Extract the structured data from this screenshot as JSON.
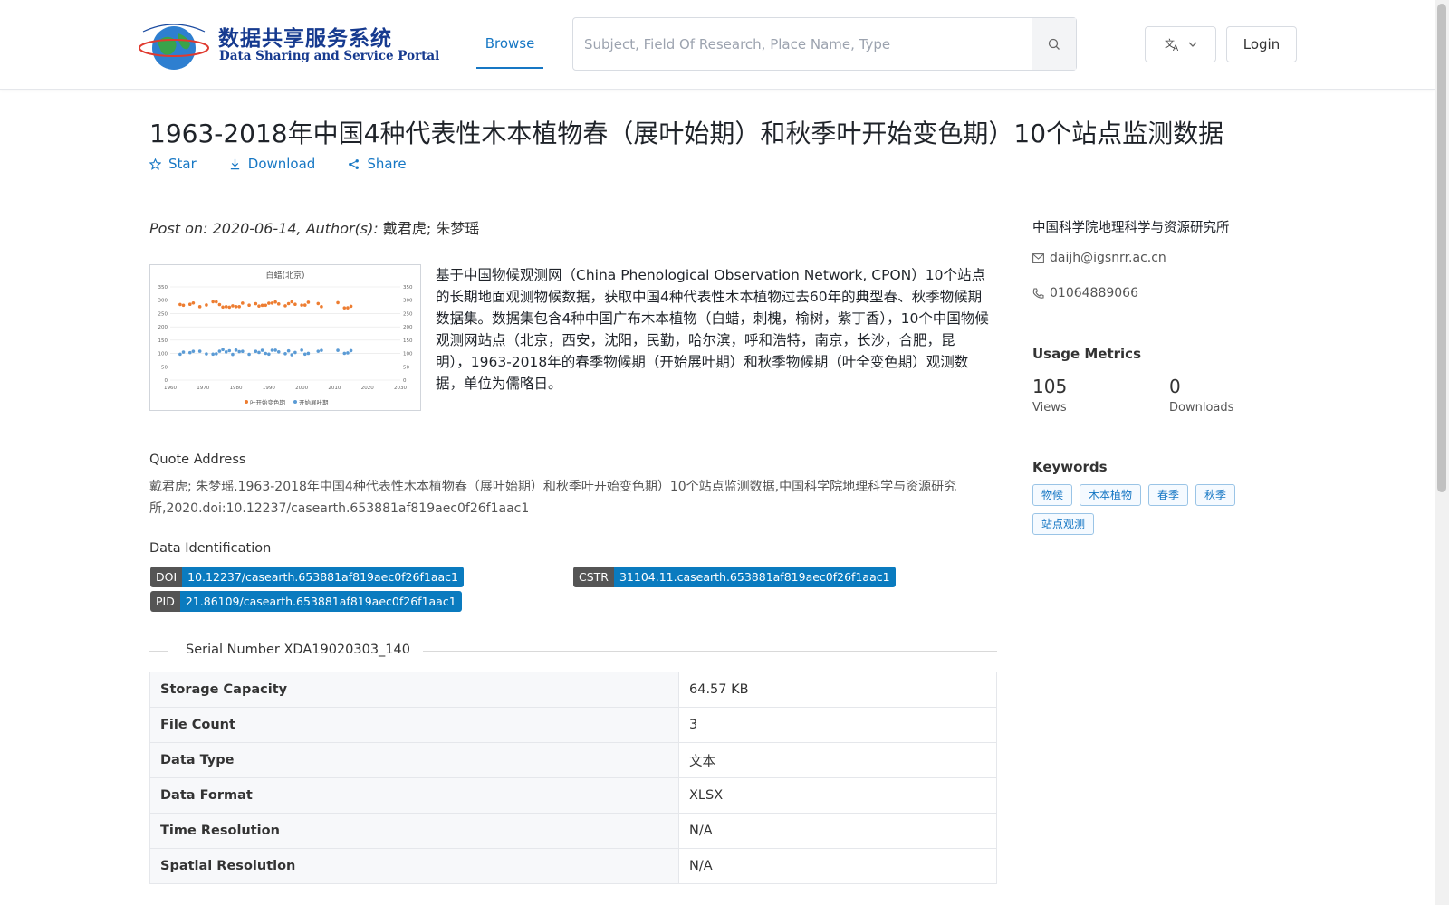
{
  "header": {
    "logo_cn": "数据共享服务系统",
    "logo_en": "Data Sharing and Service Portal",
    "nav_browse": "Browse",
    "search_placeholder": "Subject, Field Of Research, Place Name, Type",
    "login": "Login"
  },
  "dataset": {
    "title": "1963-2018年中国4种代表性木本植物春（展叶始期）和秋季叶开始变色期）10个站点监测数据",
    "actions": {
      "star": "Star",
      "download": "Download",
      "share": "Share"
    },
    "meta_prefix": "Post on: 2020-06-14, Author(s):",
    "authors": "戴君虎; 朱梦瑶",
    "abstract": "基于中国物候观测网（China Phenological Observation Network, CPON）10个站点的长期地面观测物候数据，获取中国4种代表性木本植物过去60年的典型春、秋季物候期数据集。数据集包含4种中国广布木本植物（白蜡，刺槐，榆树，紫丁香），10个中国物候观测网站点（北京，西安，沈阳，民勤，哈尔滨，呼和浩特，南京，长沙，合肥，昆明），1963-2018年的春季物候期（开始展叶期）和秋季物候期（叶全变色期）观测数据，单位为儒略日。",
    "quote_label": "Quote Address",
    "quote": "戴君虎; 朱梦瑶.1963-2018年中国4种代表性木本植物春（展叶始期）和秋季叶开始变色期）10个站点监测数据,中国科学院地理科学与资源研究所,2020.doi:10.12237/casearth.653881af819aec0f26f1aac1",
    "identification_label": "Data Identification",
    "ids": {
      "doi_k": "DOI",
      "doi_v": "10.12237/casearth.653881af819aec0f26f1aac1",
      "cstr_k": "CSTR",
      "cstr_v": "31104.11.casearth.653881af819aec0f26f1aac1",
      "pid_k": "PID",
      "pid_v": "21.86109/casearth.653881af819aec0f26f1aac1"
    },
    "serial": "Serial Number XDA19020303_140",
    "properties": [
      {
        "k": "Storage Capacity",
        "v": "64.57 KB"
      },
      {
        "k": "File Count",
        "v": "3"
      },
      {
        "k": "Data Type",
        "v": "文本"
      },
      {
        "k": "Data Format",
        "v": "XLSX"
      },
      {
        "k": "Time Resolution",
        "v": "N/A"
      },
      {
        "k": "Spatial Resolution",
        "v": "N/A"
      }
    ]
  },
  "thumbnail": {
    "title": "白蜡(北京)",
    "legend_autumn": "叶开始变色期",
    "legend_spring": "开始展叶期",
    "colors": {
      "autumn": "#ed7d31",
      "spring": "#5b9bd5"
    },
    "x_ticks": [
      "1960",
      "1970",
      "1980",
      "1990",
      "2000",
      "2010",
      "2020",
      "2030"
    ],
    "y_ticks": [
      "0",
      "50",
      "100",
      "150",
      "200",
      "250",
      "300",
      "350"
    ]
  },
  "sidebar": {
    "org": "中国科学院地理科学与资源研究所",
    "email": "daijh@igsnrr.ac.cn",
    "phone": "01064889066",
    "metrics_title": "Usage Metrics",
    "views_num": "105",
    "views_label": "Views",
    "downloads_num": "0",
    "downloads_label": "Downloads",
    "keywords_title": "Keywords",
    "keywords": [
      "物候",
      "木本植物",
      "春季",
      "秋季",
      "站点观测"
    ]
  }
}
